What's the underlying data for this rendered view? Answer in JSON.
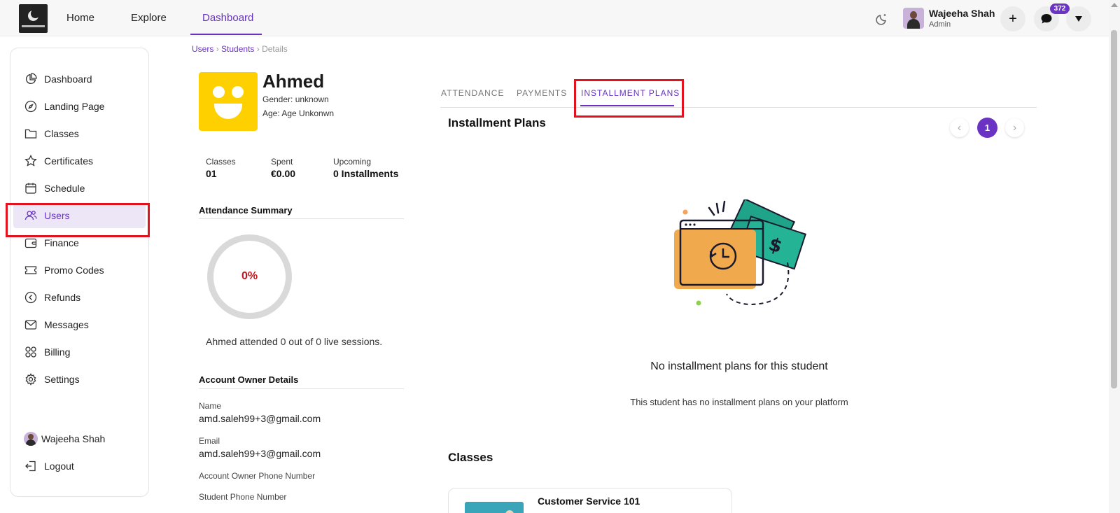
{
  "topbar": {
    "nav": [
      {
        "label": "Home"
      },
      {
        "label": "Explore"
      },
      {
        "label": "Dashboard"
      }
    ],
    "user_name": "Wajeeha Shah",
    "user_role": "Admin",
    "plus_icon": "+",
    "notifications_count": "372"
  },
  "sidebar": {
    "items": [
      {
        "label": "Dashboard",
        "icon": "pie-chart-icon"
      },
      {
        "label": "Landing Page",
        "icon": "compass-icon"
      },
      {
        "label": "Classes",
        "icon": "folder-icon"
      },
      {
        "label": "Certificates",
        "icon": "star-icon"
      },
      {
        "label": "Schedule",
        "icon": "calendar-icon"
      },
      {
        "label": "Users",
        "icon": "users-icon"
      },
      {
        "label": "Finance",
        "icon": "wallet-icon"
      },
      {
        "label": "Promo Codes",
        "icon": "ticket-icon"
      },
      {
        "label": "Refunds",
        "icon": "refund-icon"
      },
      {
        "label": "Messages",
        "icon": "mail-icon"
      },
      {
        "label": "Billing",
        "icon": "grid-icon"
      },
      {
        "label": "Settings",
        "icon": "gear-icon"
      }
    ],
    "footer_user": "Wajeeha Shah",
    "logout_label": "Logout"
  },
  "breadcrumb": {
    "users": "Users",
    "students": "Students",
    "current": "Details",
    "sep": "›"
  },
  "student": {
    "name": "Ahmed",
    "gender": "Gender: unknown",
    "age": "Age: Age Unkonwn",
    "stats": [
      {
        "label": "Classes",
        "value": "01"
      },
      {
        "label": "Spent",
        "value": "€0.00"
      },
      {
        "label": "Upcoming",
        "value": "0 Installments"
      }
    ]
  },
  "attendance": {
    "title": "Attendance Summary",
    "percent": "0%",
    "summary": "Ahmed attended 0 out of 0 live sessions."
  },
  "account": {
    "title": "Account Owner Details",
    "name_label": "Name",
    "name_value": "amd.saleh99+3@gmail.com",
    "email_label": "Email",
    "email_value": "amd.saleh99+3@gmail.com",
    "owner_phone_label": "Account Owner Phone Number",
    "student_phone_label": "Student Phone Number"
  },
  "tabs": [
    {
      "label": "ATTENDANCE"
    },
    {
      "label": "PAYMENTS"
    },
    {
      "label": "INSTALLMENT PLANS"
    }
  ],
  "installments": {
    "title": "Installment Plans",
    "page": "1",
    "prev": "‹",
    "next": "›",
    "empty_title": "No installment plans for this student",
    "empty_sub": "This student has no installment plans on your platform"
  },
  "classes": {
    "title": "Classes",
    "items": [
      {
        "name": "Customer Service 101"
      }
    ]
  },
  "colors": {
    "accent": "#6a33c4",
    "highlight_box": "#e0131f",
    "avatar": "#ffd000",
    "percent_text": "#c0141a"
  }
}
